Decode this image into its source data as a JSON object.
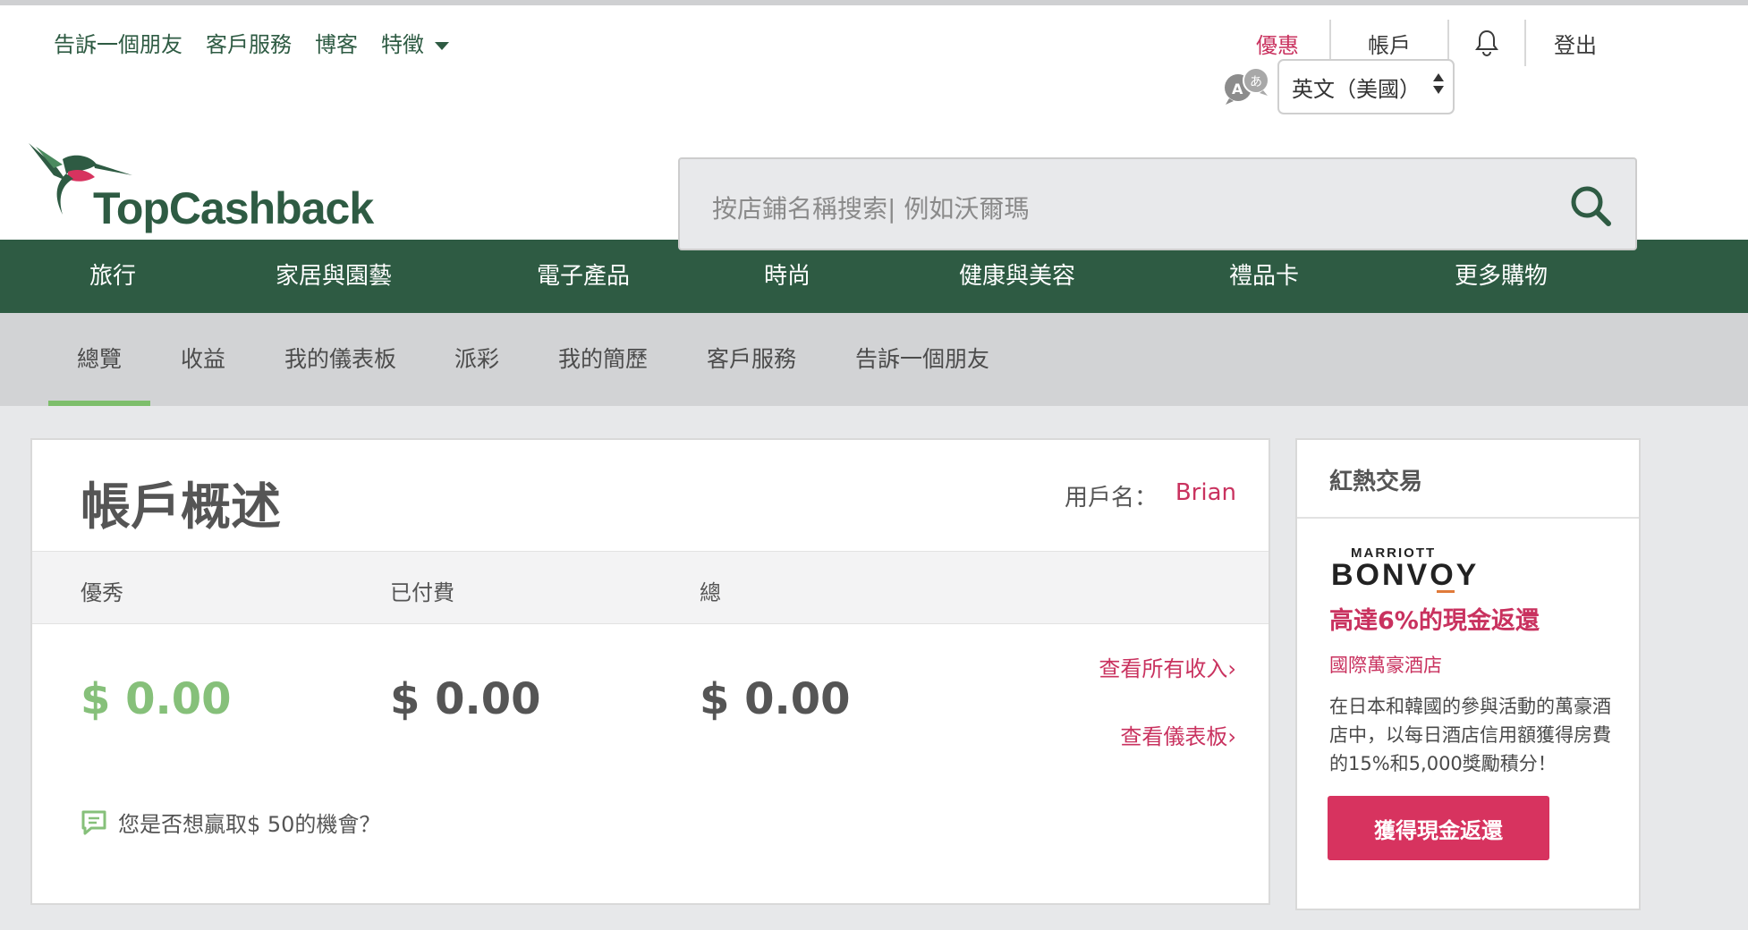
{
  "top_links": {
    "tell_friend": "告訴一個朋友",
    "customer_service": "客戶服務",
    "blog": "博客",
    "features": "特徵"
  },
  "account_bar": {
    "offers": "優惠",
    "account": "帳戶",
    "logout": "登出"
  },
  "language": {
    "selected": "英文（美國）"
  },
  "logo": {
    "text": "TopCashback"
  },
  "search": {
    "placeholder": "按店鋪名稱搜索|  例如沃爾瑪"
  },
  "main_nav": [
    "旅行",
    "家居與園藝",
    "電子產品",
    "時尚",
    "健康與美容",
    "禮品卡",
    "更多購物"
  ],
  "sub_nav": [
    "總覽",
    "收益",
    "我的儀表板",
    "派彩",
    "我的簡歷",
    "客戶服務",
    "告訴一個朋友"
  ],
  "account_summary": {
    "title": "帳戶概述",
    "username_label": "用戶名：",
    "username": "Brian",
    "columns": [
      "優秀",
      "已付費",
      "總"
    ],
    "amounts": [
      "$ 0.00",
      "$ 0.00",
      "$ 0.00"
    ],
    "link_all_earnings": "查看所有收入›",
    "link_dashboard": "查看儀表板›",
    "prompt": "您是否想贏取$ 50的機會？"
  },
  "hot_deal": {
    "title": "紅熱交易",
    "brand_top": "MARRIOTT",
    "brand_bottom": "BONVOY",
    "headline": "高達6%的現金返還",
    "merchant": "國際萬豪酒店",
    "description": "在日本和韓國的參與活動的萬豪酒店中，以每日酒店信用額獲得房費的15%和5,000獎勵積分！",
    "button": "獲得現金返還"
  },
  "colors": {
    "brand_green": "#2e5b43",
    "accent_pink": "#c9325f",
    "earnings_green": "#86c07a",
    "button_pink": "#d7335f"
  }
}
